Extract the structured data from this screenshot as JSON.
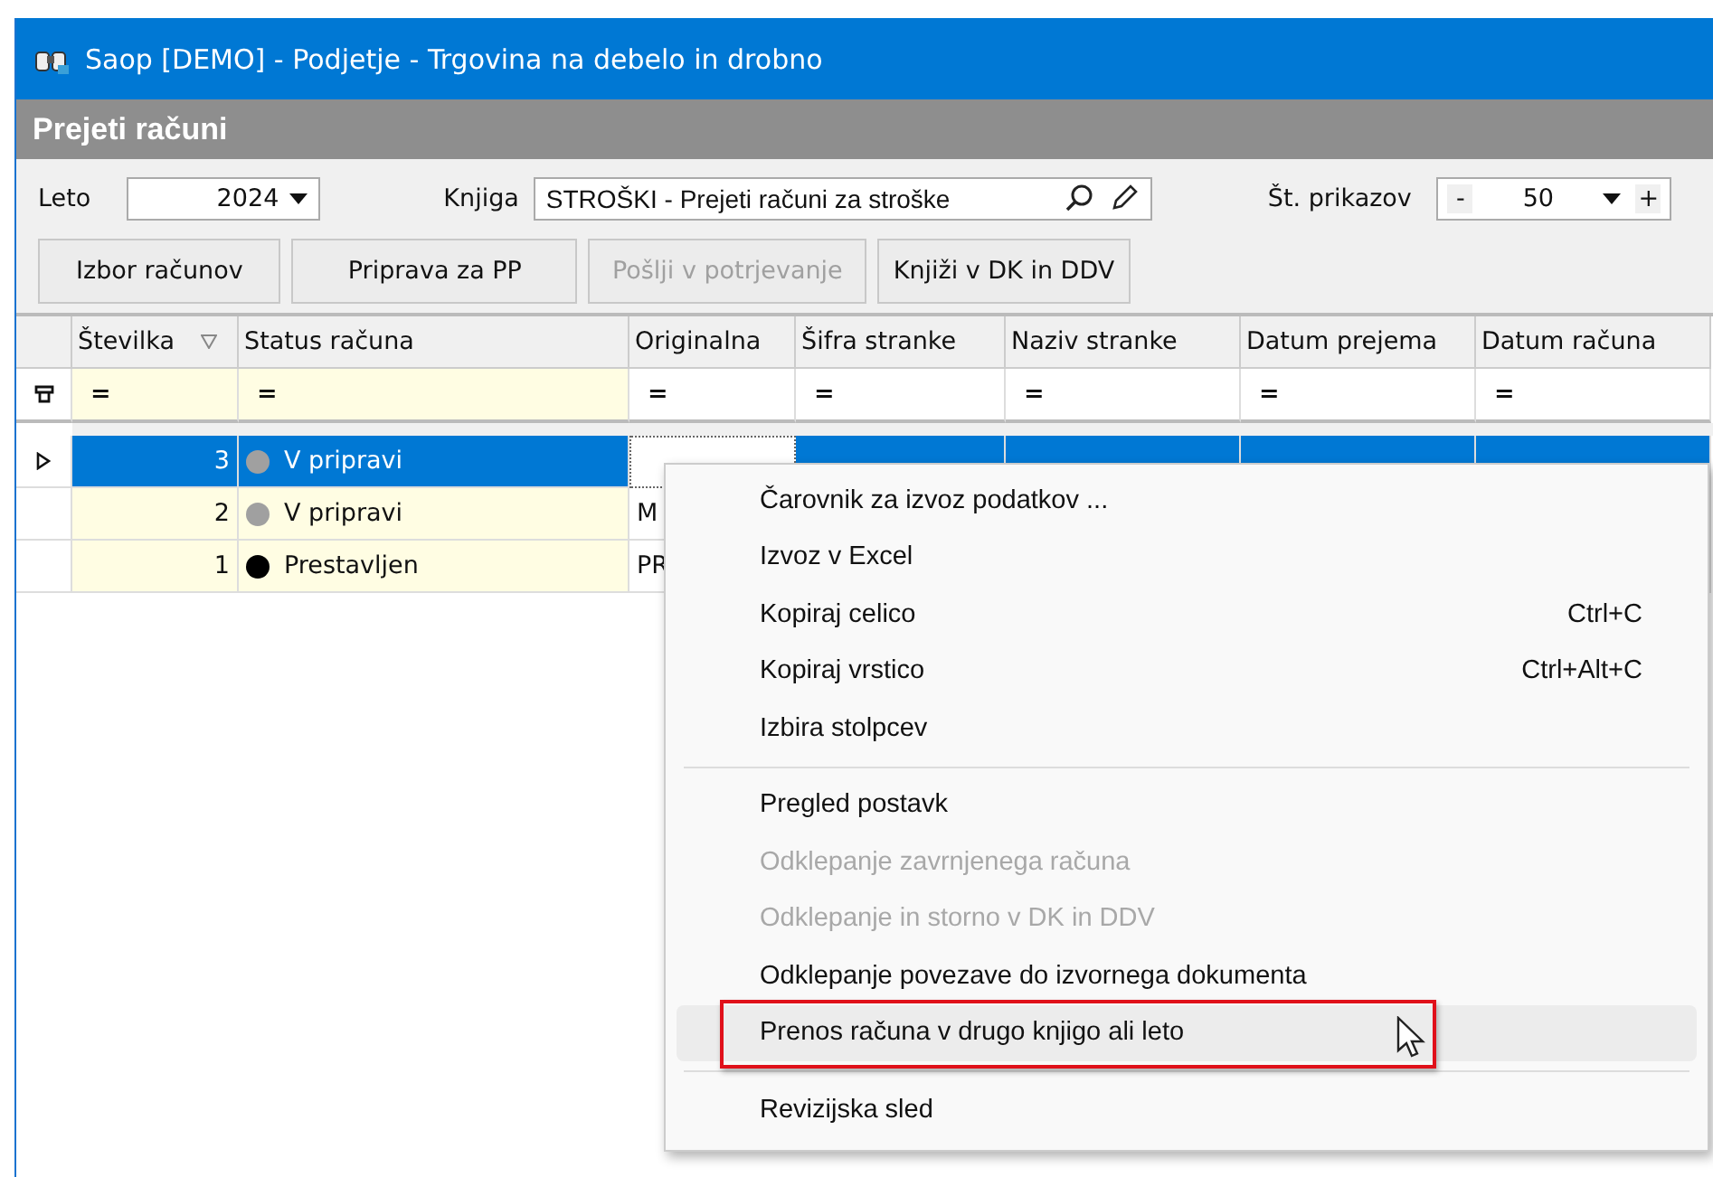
{
  "window": {
    "title": "Saop  [DEMO] - Podjetje - Trgovina na debelo in drobno"
  },
  "panel": {
    "title": "Prejeti računi"
  },
  "filters": {
    "year_label": "Leto",
    "year_value": "2024",
    "book_label": "Knjiga",
    "book_value": "STROŠKI - Prejeti računi za stroške",
    "count_label": "Št. prikazov",
    "count_minus": "-",
    "count_value": "50",
    "count_plus": "+"
  },
  "buttons": [
    {
      "label": "Izbor računov",
      "disabled": false
    },
    {
      "label": "Priprava za PP",
      "disabled": false
    },
    {
      "label": "Pošlji v potrjevanje",
      "disabled": true
    },
    {
      "label": "Knjiži v DK in DDV",
      "disabled": false
    }
  ],
  "table": {
    "columns": [
      "Številka",
      "Status računa",
      "Originalna",
      "Šifra stranke",
      "Naziv stranke",
      "Datum prejema",
      "Datum računa"
    ],
    "filter_row": [
      "=",
      "=",
      "=",
      "=",
      "=",
      "=",
      "="
    ],
    "rows": [
      {
        "number": "3",
        "status": "V pripravi",
        "color": "#a0a0a0",
        "selected": true
      },
      {
        "number": "2",
        "status": "V pripravi",
        "color": "#a0a0a0",
        "original": "M",
        "selected": false
      },
      {
        "number": "1",
        "status": "Prestavljen",
        "color": "#000000",
        "original": "PR",
        "selected": false
      }
    ]
  },
  "context_menu": {
    "items": [
      {
        "label": "Čarovnik za izvoz podatkov ...",
        "disabled": false,
        "separator_before": false,
        "selected": false
      },
      {
        "label": "Izvoz v Excel",
        "disabled": false,
        "separator_before": false,
        "selected": false
      },
      {
        "label": "Kopiraj celico",
        "shortcut": "Ctrl+C",
        "disabled": false,
        "separator_before": false,
        "selected": false
      },
      {
        "label": "Kopiraj vrstico",
        "shortcut": "Ctrl+Alt+C",
        "disabled": false,
        "separator_before": false,
        "selected": false
      },
      {
        "label": "Izbira stolpcev",
        "disabled": false,
        "separator_before": false,
        "selected": false
      },
      {
        "label": "Pregled postavk",
        "disabled": false,
        "separator_before": true,
        "selected": false
      },
      {
        "label": "Odklepanje zavrnjenega računa",
        "disabled": true,
        "separator_before": false,
        "selected": false
      },
      {
        "label": "Odklepanje in storno v DK in DDV",
        "disabled": true,
        "separator_before": false,
        "selected": false
      },
      {
        "label": "Odklepanje povezave do izvornega dokumenta",
        "disabled": false,
        "separator_before": false,
        "selected": false
      },
      {
        "label": "Prenos računa v drugo knjigo ali leto",
        "disabled": false,
        "separator_before": false,
        "selected": true
      },
      {
        "label": "Revizijska sled",
        "disabled": false,
        "separator_before": true,
        "selected": false
      }
    ]
  }
}
